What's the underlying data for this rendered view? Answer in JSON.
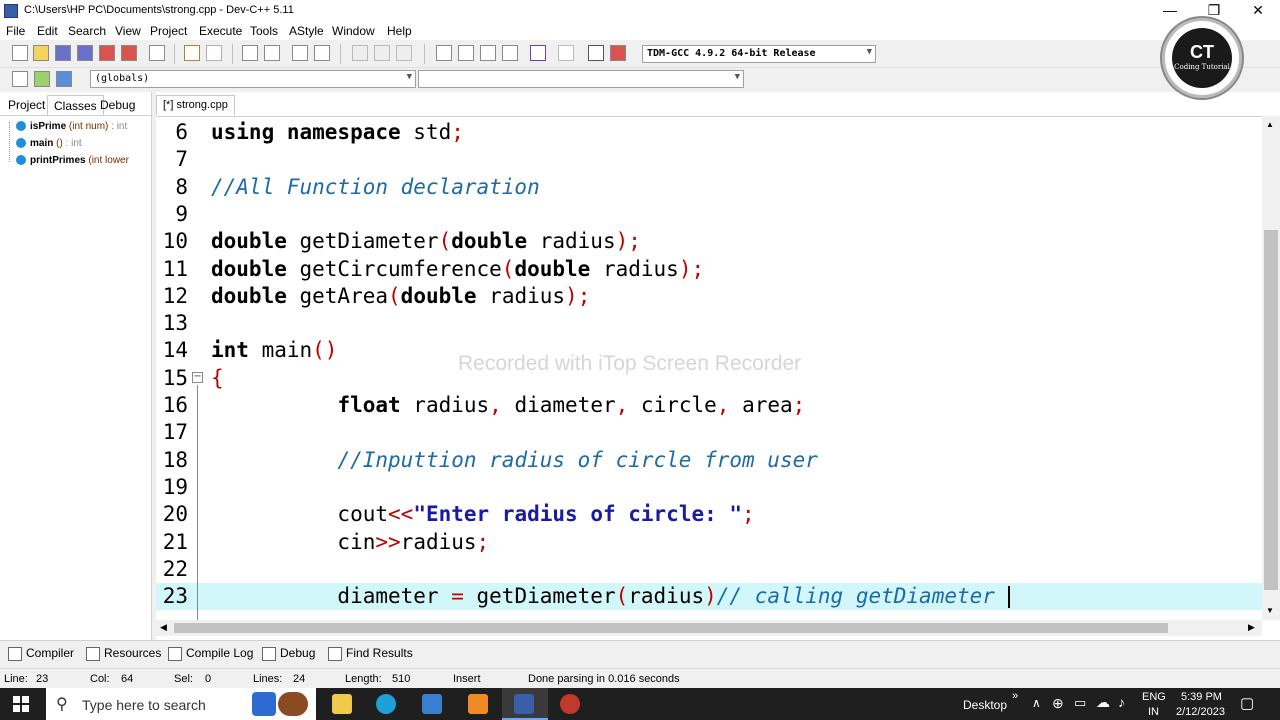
{
  "window": {
    "title": "C:\\Users\\HP PC\\Documents\\strong.cpp - Dev-C++ 5.11",
    "minimize": "—",
    "maximize": "❐",
    "close": "✕"
  },
  "menu": [
    "File",
    "Edit",
    "Search",
    "View",
    "Project",
    "Execute",
    "Tools",
    "AStyle",
    "Window",
    "Help"
  ],
  "toolbar": {
    "compiler_select": "TDM-GCC 4.9.2 64-bit Release",
    "scope_select": "(globals)",
    "member_select": ""
  },
  "left_panel": {
    "tabs": [
      "Project",
      "Classes",
      "Debug"
    ],
    "active_tab": "Classes",
    "items": [
      {
        "name": "isPrime",
        "sig": "(int num)",
        "ret": ": int"
      },
      {
        "name": "main",
        "sig": "()",
        "ret": ": int"
      },
      {
        "name": "printPrimes",
        "sig": "(int lower",
        "ret": ""
      }
    ]
  },
  "editor": {
    "file_tab": "[*] strong.cpp",
    "current_line": 23
  },
  "code_lines": [
    {
      "n": "6",
      "segs": [
        {
          "t": "using namespace",
          "c": "kw"
        },
        {
          "t": " std",
          "c": ""
        },
        {
          "t": ";",
          "c": "br"
        }
      ]
    },
    {
      "n": "7",
      "segs": []
    },
    {
      "n": "8",
      "segs": [
        {
          "t": "//All Function declaration",
          "c": "cm"
        }
      ]
    },
    {
      "n": "9",
      "segs": []
    },
    {
      "n": "10",
      "segs": [
        {
          "t": "double",
          "c": "kw"
        },
        {
          "t": " getDiameter",
          "c": ""
        },
        {
          "t": "(",
          "c": "br"
        },
        {
          "t": "double",
          "c": "kw"
        },
        {
          "t": " radius",
          "c": ""
        },
        {
          "t": ");",
          "c": "br"
        }
      ]
    },
    {
      "n": "11",
      "segs": [
        {
          "t": "double",
          "c": "kw"
        },
        {
          "t": " getCircumference",
          "c": ""
        },
        {
          "t": "(",
          "c": "br"
        },
        {
          "t": "double",
          "c": "kw"
        },
        {
          "t": " radius",
          "c": ""
        },
        {
          "t": ");",
          "c": "br"
        }
      ]
    },
    {
      "n": "12",
      "segs": [
        {
          "t": "double",
          "c": "kw"
        },
        {
          "t": " getArea",
          "c": ""
        },
        {
          "t": "(",
          "c": "br"
        },
        {
          "t": "double",
          "c": "kw"
        },
        {
          "t": " radius",
          "c": ""
        },
        {
          "t": ");",
          "c": "br"
        }
      ]
    },
    {
      "n": "13",
      "segs": []
    },
    {
      "n": "14",
      "segs": [
        {
          "t": "int",
          "c": "kw"
        },
        {
          "t": " main",
          "c": ""
        },
        {
          "t": "()",
          "c": "br"
        }
      ]
    },
    {
      "n": "15",
      "segs": [
        {
          "t": "{",
          "c": "br"
        }
      ]
    },
    {
      "n": "16",
      "segs": [
        {
          "t": "          ",
          "c": ""
        },
        {
          "t": "float",
          "c": "kw"
        },
        {
          "t": " radius",
          "c": ""
        },
        {
          "t": ",",
          "c": "br"
        },
        {
          "t": " diameter",
          "c": ""
        },
        {
          "t": ",",
          "c": "br"
        },
        {
          "t": " circle",
          "c": ""
        },
        {
          "t": ",",
          "c": "br"
        },
        {
          "t": " area",
          "c": ""
        },
        {
          "t": ";",
          "c": "br"
        }
      ]
    },
    {
      "n": "17",
      "segs": []
    },
    {
      "n": "18",
      "segs": [
        {
          "t": "          ",
          "c": ""
        },
        {
          "t": "//Inputtion radius of circle from user",
          "c": "cm"
        }
      ]
    },
    {
      "n": "19",
      "segs": []
    },
    {
      "n": "20",
      "segs": [
        {
          "t": "          cout",
          "c": ""
        },
        {
          "t": "<<",
          "c": "br"
        },
        {
          "t": "\"Enter radius of circle: \"",
          "c": "st"
        },
        {
          "t": ";",
          "c": "br"
        }
      ]
    },
    {
      "n": "21",
      "segs": [
        {
          "t": "          cin",
          "c": ""
        },
        {
          "t": ">>",
          "c": "br"
        },
        {
          "t": "radius",
          "c": ""
        },
        {
          "t": ";",
          "c": "br"
        }
      ]
    },
    {
      "n": "22",
      "segs": []
    },
    {
      "n": "23",
      "segs": [
        {
          "t": "          diameter ",
          "c": ""
        },
        {
          "t": "=",
          "c": "br"
        },
        {
          "t": " getDiameter",
          "c": ""
        },
        {
          "t": "(",
          "c": "br"
        },
        {
          "t": "radius",
          "c": ""
        },
        {
          "t": ")",
          "c": "br"
        },
        {
          "t": "// calling getDiameter ",
          "c": "cm"
        }
      ]
    }
  ],
  "bottom_tabs": [
    "Compiler",
    "Resources",
    "Compile Log",
    "Debug",
    "Find Results"
  ],
  "status": {
    "line_label": "Line:",
    "line_value": "23",
    "col_label": "Col:",
    "col_value": "64",
    "sel_label": "Sel:",
    "sel_value": "0",
    "lines_label": "Lines:",
    "lines_value": "24",
    "length_label": "Length:",
    "length_value": "510",
    "mode": "Insert",
    "message": "Done parsing in 0.016 seconds"
  },
  "taskbar": {
    "search_placeholder": "Type here to search",
    "desktop_label": "Desktop",
    "lang_top": "ENG",
    "lang_bottom": "IN",
    "time": "5:39 PM",
    "date": "2/12/2023"
  },
  "watermark": "Recorded with iTop Screen Recorder",
  "logo": {
    "title": "CT",
    "subtitle": "Coding Tutorial"
  }
}
